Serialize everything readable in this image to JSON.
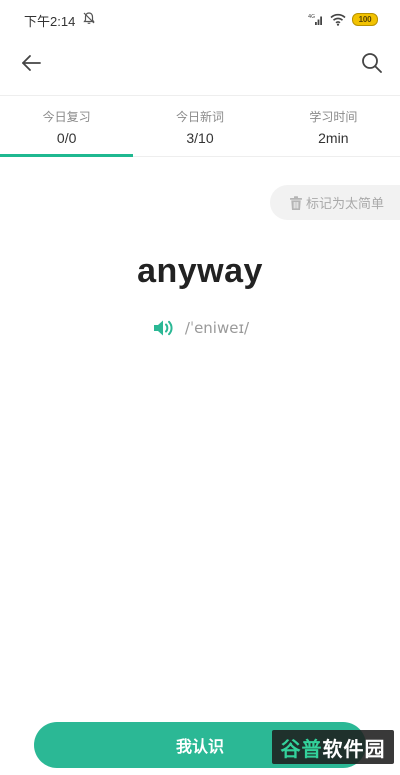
{
  "status_bar": {
    "time": "下午2:14",
    "battery": "100",
    "network": "4G"
  },
  "app_bar": {
    "back_icon": "arrow-left-icon",
    "search_icon": "search-icon"
  },
  "stats": [
    {
      "label": "今日复习",
      "value": "0/0",
      "active": true
    },
    {
      "label": "今日新词",
      "value": "3/10",
      "active": false
    },
    {
      "label": "学习时间",
      "value": "2min",
      "active": false
    }
  ],
  "too_easy": {
    "label": "标记为太简单",
    "icon": "trash-icon"
  },
  "word": {
    "text": "anyway",
    "phonetic": "/ˈeniweɪ/",
    "speaker_icon": "speaker-icon"
  },
  "actions": {
    "know_label": "我认识"
  },
  "watermark": {
    "text_a": "谷普",
    "text_b": "软件园"
  },
  "colors": {
    "accent": "#2bb895",
    "indicator": "#1fb890",
    "muted_text": "#8a8a8a",
    "pill_bg": "#f2f2f2"
  }
}
